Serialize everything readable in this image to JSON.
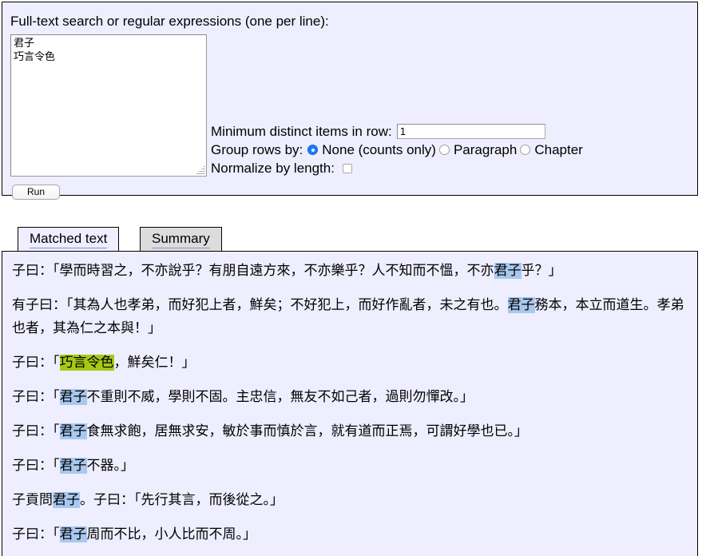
{
  "query_panel": {
    "legend": "Full-text search or regular expressions (one per line):",
    "search_textarea": {
      "value": "君子\n巧言令色",
      "placeholder": ""
    },
    "run_button_label": "Run",
    "options": {
      "min_distinct_label": "Minimum distinct items in row:",
      "min_distinct_value": "1",
      "group_rows_label": "Group rows by:",
      "group_rows_options": [
        {
          "label": "None (counts only)",
          "selected": true
        },
        {
          "label": "Paragraph",
          "selected": false
        },
        {
          "label": "Chapter",
          "selected": false
        }
      ],
      "normalize_label": "Normalize by length:",
      "normalize_checked": false
    }
  },
  "tabs": [
    {
      "label": "Matched text",
      "active": true
    },
    {
      "label": "Summary",
      "active": false
    }
  ],
  "results": {
    "rows": [
      [
        {
          "t": "子曰：「學而時習之，不亦說乎？有朋自遠方來，不亦樂乎？人不知而不慍，不亦",
          "h": "none"
        },
        {
          "t": "君子",
          "h": "blue"
        },
        {
          "t": "乎？」",
          "h": "none"
        }
      ],
      [
        {
          "t": "有子曰：「其為人也孝弟，而好犯上者，鮮矣；不好犯上，而好作亂者，未之有也。",
          "h": "none"
        },
        {
          "t": "君子",
          "h": "blue"
        },
        {
          "t": "務本，本立而道生。孝弟也者，其為仁之本與！」",
          "h": "none"
        }
      ],
      [
        {
          "t": "子曰：「",
          "h": "none"
        },
        {
          "t": "巧言令色",
          "h": "green"
        },
        {
          "t": "，鮮矣仁！」",
          "h": "none"
        }
      ],
      [
        {
          "t": "子曰：「",
          "h": "none"
        },
        {
          "t": "君子",
          "h": "blue"
        },
        {
          "t": "不重則不威，學則不固。主忠信，無友不如己者，過則勿憚改。」",
          "h": "none"
        }
      ],
      [
        {
          "t": "子曰：「",
          "h": "none"
        },
        {
          "t": "君子",
          "h": "blue"
        },
        {
          "t": "食無求飽，居無求安，敏於事而慎於言，就有道而正焉，可謂好學也已。」",
          "h": "none"
        }
      ],
      [
        {
          "t": "子曰：「",
          "h": "none"
        },
        {
          "t": "君子",
          "h": "blue"
        },
        {
          "t": "不器。」",
          "h": "none"
        }
      ],
      [
        {
          "t": "子貢問",
          "h": "none"
        },
        {
          "t": "君子",
          "h": "blue"
        },
        {
          "t": "。子曰：「先行其言，而後從之。」",
          "h": "none"
        }
      ],
      [
        {
          "t": "子曰：「",
          "h": "none"
        },
        {
          "t": "君子",
          "h": "blue"
        },
        {
          "t": "周而不比，小人比而不周。」",
          "h": "none"
        }
      ]
    ]
  },
  "colors": {
    "panel_background": "#eeeeff",
    "page_background": "#ffffff",
    "highlight_blue": "#a8c8f0",
    "highlight_green": "#a8c814",
    "radio_accent": "#1a7aff",
    "inactive_tab": "#dcdcdc"
  }
}
